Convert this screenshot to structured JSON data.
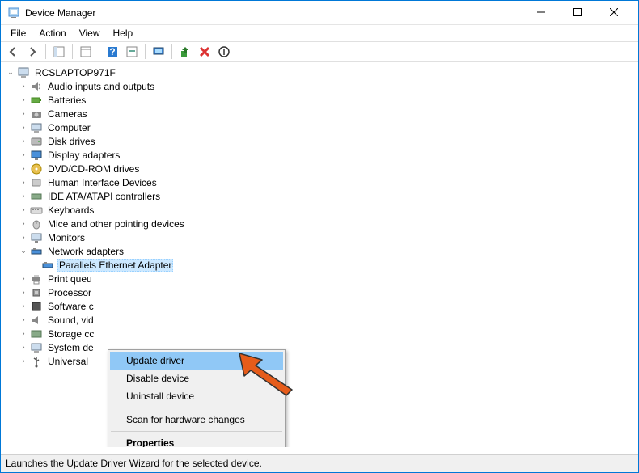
{
  "window": {
    "title": "Device Manager"
  },
  "menu": {
    "file": "File",
    "action": "Action",
    "view": "View",
    "help": "Help"
  },
  "tree": {
    "root": "RCSLAPTOP971F",
    "items": [
      "Audio inputs and outputs",
      "Batteries",
      "Cameras",
      "Computer",
      "Disk drives",
      "Display adapters",
      "DVD/CD-ROM drives",
      "Human Interface Devices",
      "IDE ATA/ATAPI controllers",
      "Keyboards",
      "Mice and other pointing devices",
      "Monitors",
      "Network adapters",
      "Print queu",
      "Processor",
      "Software c",
      "Sound, vid",
      "Storage cc",
      "System de",
      "Universal"
    ],
    "selected": "Parallels Ethernet Adapter"
  },
  "context_menu": {
    "update": "Update driver",
    "disable": "Disable device",
    "uninstall": "Uninstall device",
    "scan": "Scan for hardware changes",
    "properties": "Properties"
  },
  "statusbar": {
    "text": "Launches the Update Driver Wizard for the selected device."
  }
}
